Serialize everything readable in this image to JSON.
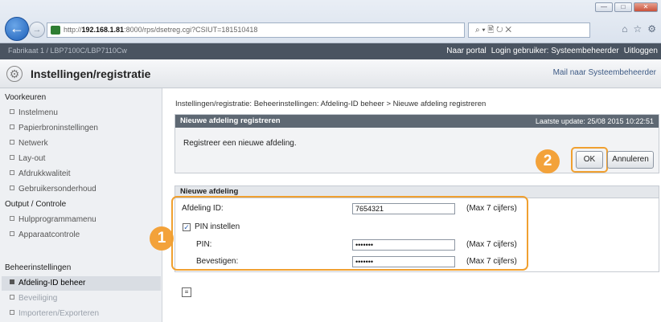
{
  "browser": {
    "url_prefix": "http://",
    "url_host": "192.168.1.81",
    "url_rest": ":8000/rps/dsetreg.cgi?CSIUT=181510418",
    "search_text": "⌕ ▾ 🖹 ↻ ✕",
    "window_controls": [
      "—",
      "□",
      "✕"
    ],
    "tools": [
      "⌂",
      "☆",
      "⚙"
    ]
  },
  "topbar": {
    "brand": "Fabrikaat 1 / LBP7100C/LBP7110Cw",
    "portal": "Naar portal",
    "login": "Login gebruiker: Systeembeheerder",
    "logout": "Uitloggen"
  },
  "header": {
    "title": "Instellingen/registratie",
    "mail": "Mail naar Systeembeheerder"
  },
  "sidebar": {
    "groups": [
      {
        "label": "Voorkeuren"
      },
      {
        "label": "Output / Controle"
      },
      {
        "label": "Beheerinstellingen"
      }
    ],
    "items": [
      {
        "label": "Instelmenu"
      },
      {
        "label": "Papierbroninstellingen"
      },
      {
        "label": "Netwerk"
      },
      {
        "label": "Lay-out"
      },
      {
        "label": "Afdrukkwaliteit"
      },
      {
        "label": "Gebruikersonderhoud"
      },
      {
        "label": "Hulpprogrammamenu"
      },
      {
        "label": "Apparaatcontrole"
      },
      {
        "label": "Afdeling-ID beheer"
      },
      {
        "label": "Beveiliging"
      },
      {
        "label": "Importeren/Exporteren"
      }
    ]
  },
  "breadcrumb": "Instellingen/registratie: Beheerinstellingen: Afdeling-ID beheer > Nieuwe afdeling registreren",
  "panel": {
    "title": "Nieuwe afdeling registreren",
    "updated": "Laatste update: 25/08 2015 10:22:51",
    "message": "Registreer een nieuwe afdeling.",
    "ok": "OK",
    "cancel": "Annuleren"
  },
  "form": {
    "section": "Nieuwe afdeling",
    "dept_label": "Afdeling ID:",
    "dept_value": "7654321",
    "hint": "(Max 7 cijfers)",
    "pin_toggle": "PIN instellen",
    "pin_label": "PIN:",
    "pin_value": "•••••••",
    "confirm_label": "Bevestigen:",
    "confirm_value": "•••••••"
  },
  "callouts": [
    "1",
    "2"
  ],
  "colors": {
    "callout": "#f3a23a",
    "header_bar": "#5e6873",
    "topbar": "#4a5461"
  }
}
